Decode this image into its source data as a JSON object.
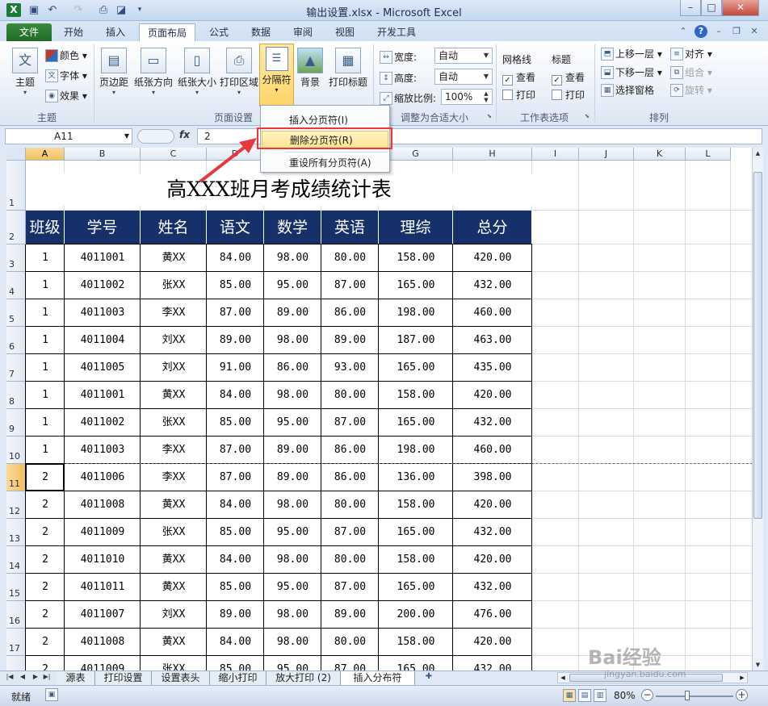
{
  "window": {
    "title": "输出设置.xlsx - Microsoft Excel",
    "app_icon": "X"
  },
  "quick_access": {
    "save": "save-icon",
    "undo": "undo-icon",
    "redo": "redo-icon",
    "print": "print-icon",
    "preview": "preview-icon"
  },
  "tabs": {
    "file": "文件",
    "items": [
      "开始",
      "插入",
      "页面布局",
      "公式",
      "数据",
      "审阅",
      "视图",
      "开发工具"
    ],
    "active": "页面布局"
  },
  "ribbon": {
    "themes": {
      "theme": "主题",
      "colors": "颜色",
      "fonts": "字体",
      "effects": "效果",
      "group": "主题"
    },
    "page_setup": {
      "margins": "页边距",
      "orientation": "纸张方向",
      "size": "纸张大小",
      "print_area": "打印区域",
      "breaks": "分隔符",
      "background": "背景",
      "print_titles": "打印标题",
      "group": "页面设置"
    },
    "scale": {
      "width_label": "宽度:",
      "width_value": "自动",
      "height_label": "高度:",
      "height_value": "自动",
      "scale_label": "缩放比例:",
      "scale_value": "100%",
      "group": "调整为合适大小"
    },
    "sheet_options": {
      "gridlines": "网格线",
      "headings": "标题",
      "view": "查看",
      "print": "打印",
      "group": "工作表选项"
    },
    "arrange": {
      "bring_forward": "上移一层",
      "send_backward": "下移一层",
      "selection_pane": "选择窗格",
      "align": "对齐",
      "group_btn": "组合",
      "rotate": "旋转",
      "group": "排列"
    }
  },
  "menu": {
    "items": [
      "插入分页符(I)",
      "删除分页符(R)",
      "重设所有分页符(A)"
    ],
    "highlighted": 1
  },
  "formula_bar": {
    "name_box": "A11",
    "fx": "fx",
    "value": "2"
  },
  "columns": [
    "A",
    "B",
    "C",
    "D",
    "E",
    "F",
    "G",
    "H",
    "I",
    "J",
    "K",
    "L"
  ],
  "selected_cell": {
    "column": "A",
    "row": "11"
  },
  "sheet": {
    "title": "高XXX班月考成绩统计表",
    "headers": [
      "班级",
      "学号",
      "姓名",
      "语文",
      "数学",
      "英语",
      "理综",
      "总分"
    ],
    "rows": [
      [
        "1",
        "4011001",
        "黄XX",
        "84.00",
        "98.00",
        "80.00",
        "158.00",
        "420.00"
      ],
      [
        "1",
        "4011002",
        "张XX",
        "85.00",
        "95.00",
        "87.00",
        "165.00",
        "432.00"
      ],
      [
        "1",
        "4011003",
        "李XX",
        "87.00",
        "89.00",
        "86.00",
        "198.00",
        "460.00"
      ],
      [
        "1",
        "4011004",
        "刘XX",
        "89.00",
        "98.00",
        "89.00",
        "187.00",
        "463.00"
      ],
      [
        "1",
        "4011005",
        "刘XX",
        "91.00",
        "86.00",
        "93.00",
        "165.00",
        "435.00"
      ],
      [
        "1",
        "4011001",
        "黄XX",
        "84.00",
        "98.00",
        "80.00",
        "158.00",
        "420.00"
      ],
      [
        "1",
        "4011002",
        "张XX",
        "85.00",
        "95.00",
        "87.00",
        "165.00",
        "432.00"
      ],
      [
        "1",
        "4011003",
        "李XX",
        "87.00",
        "89.00",
        "86.00",
        "198.00",
        "460.00"
      ],
      [
        "2",
        "4011006",
        "李XX",
        "87.00",
        "89.00",
        "86.00",
        "136.00",
        "398.00"
      ],
      [
        "2",
        "4011008",
        "黄XX",
        "84.00",
        "98.00",
        "80.00",
        "158.00",
        "420.00"
      ],
      [
        "2",
        "4011009",
        "张XX",
        "85.00",
        "95.00",
        "87.00",
        "165.00",
        "432.00"
      ],
      [
        "2",
        "4011010",
        "黄XX",
        "84.00",
        "98.00",
        "80.00",
        "158.00",
        "420.00"
      ],
      [
        "2",
        "4011011",
        "黄XX",
        "85.00",
        "95.00",
        "87.00",
        "165.00",
        "432.00"
      ],
      [
        "2",
        "4011007",
        "刘XX",
        "89.00",
        "98.00",
        "89.00",
        "200.00",
        "476.00"
      ],
      [
        "2",
        "4011008",
        "黄XX",
        "84.00",
        "98.00",
        "80.00",
        "158.00",
        "420.00"
      ],
      [
        "2",
        "4011009",
        "张XX",
        "85.00",
        "95.00",
        "87.00",
        "165.00",
        "432.00"
      ]
    ],
    "row_numbers": [
      "1",
      "2",
      "3",
      "4",
      "5",
      "6",
      "7",
      "8",
      "9",
      "10",
      "11",
      "12",
      "13",
      "14",
      "15",
      "16",
      "17",
      "18"
    ]
  },
  "sheet_tabs": {
    "items": [
      "源表",
      "打印设置",
      "设置表头",
      "缩小打印",
      "放大打印 (2)",
      "插入分布符"
    ],
    "active": "插入分布符"
  },
  "status": {
    "ready": "就绪",
    "zoom": "80%"
  },
  "watermark": {
    "logo": "Bai经验",
    "url": "jingyan.baidu.com"
  },
  "colors": {
    "header_fill": "#16316a",
    "accent_red": "#e8383d",
    "ribbon_highlight": "#ffd56a"
  }
}
